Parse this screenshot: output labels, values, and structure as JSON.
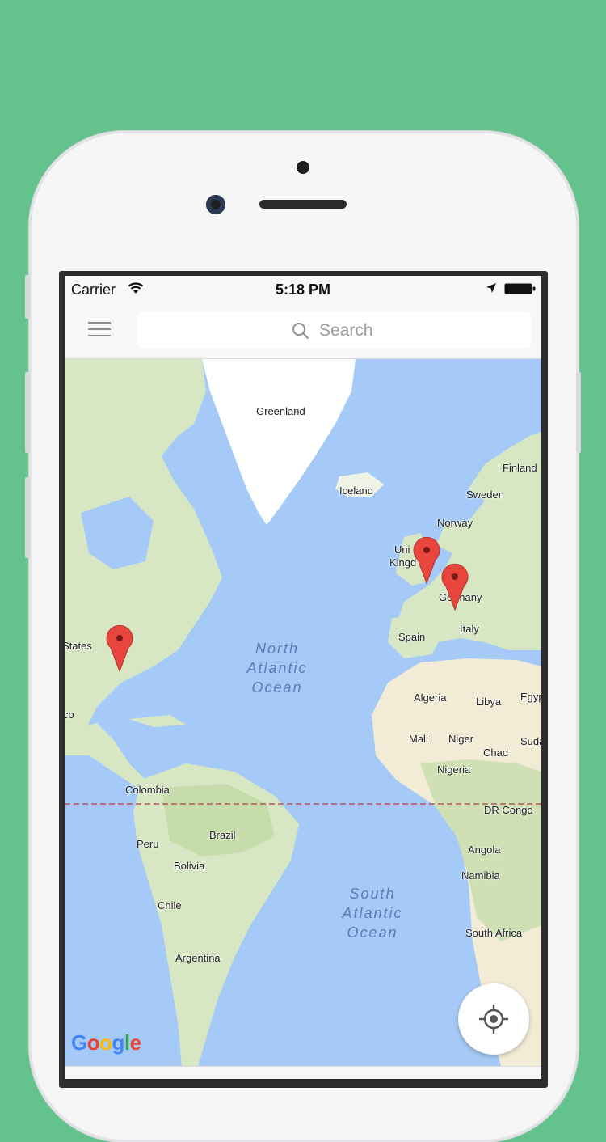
{
  "status_bar": {
    "carrier": "Carrier",
    "time": "5:18 PM"
  },
  "search": {
    "placeholder": "Search"
  },
  "map": {
    "labels": {
      "greenland": "Greenland",
      "iceland": "Iceland",
      "finland": "Finland",
      "sweden": "Sweden",
      "norway": "Norway",
      "uk_line1": "Uni",
      "uk_line2": "Kingd",
      "germany": "Germany",
      "italy": "Italy",
      "spain": "Spain",
      "states": "States",
      "algeria": "Algeria",
      "libya": "Libya",
      "egypt": "Egyp",
      "mali": "Mali",
      "niger": "Niger",
      "chad": "Chad",
      "sudan": "Suda",
      "nigeria": "Nigeria",
      "colombia": "Colombia",
      "dr_congo": "DR Congo",
      "brazil": "Brazil",
      "peru": "Peru",
      "bolivia": "Bolivia",
      "angola": "Angola",
      "namibia": "Namibia",
      "chile": "Chile",
      "south_africa": "South Africa",
      "argentina": "Argentina",
      "mexico_fragment": "co"
    },
    "north_atlantic": [
      "North",
      "Atlantic",
      "Ocean"
    ],
    "south_atlantic": [
      "South",
      "Atlantic",
      "Ocean"
    ],
    "google_logo": [
      "G",
      "o",
      "o",
      "g",
      "l",
      "e"
    ],
    "google_colors": [
      "#4285F4",
      "#EA4335",
      "#FBBC05",
      "#4285F4",
      "#34A853",
      "#EA4335"
    ],
    "pin_color": "#e8453c",
    "water_color": "#a6caf7",
    "land_color": "#d7e7c3"
  }
}
